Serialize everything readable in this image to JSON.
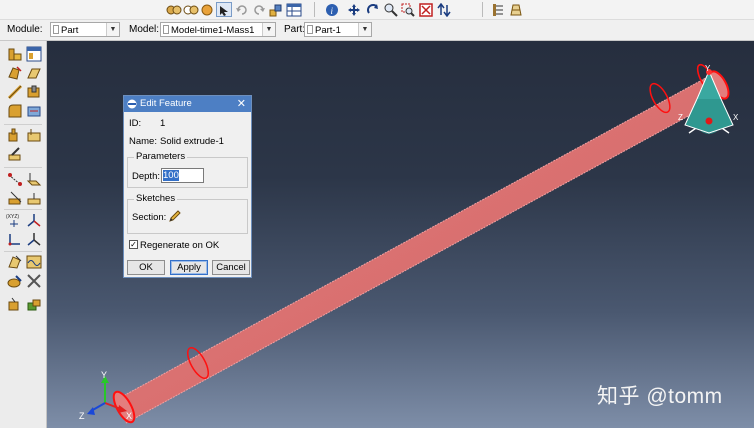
{
  "toolbar_icons": [
    "view-icon",
    "view2-icon",
    "ball-icon",
    "select-arrow-icon",
    "undo-icon",
    "redo-icon",
    "pan-icon",
    "table-icon",
    "info-icon",
    "move-icon",
    "rotate-icon",
    "zoom-icon",
    "zoom-box-icon",
    "fit-icon",
    "swap-icon",
    "tree-icon",
    "layer-icon"
  ],
  "context": {
    "module_label": "Module:",
    "module_value": "Part",
    "model_label": "Model:",
    "model_value": "Model-time1-Mass1",
    "part_label": "Part:",
    "part_value": "Part-1"
  },
  "dialog": {
    "title": "Edit Feature",
    "close": "✕",
    "id_label": "ID:",
    "id_value": "1",
    "name_label": "Name:",
    "name_value": "Solid extrude-1",
    "parameters_label": "Parameters",
    "depth_label": "Depth:",
    "depth_value": "100",
    "sketches_label": "Sketches",
    "section_label": "Section:",
    "regenerate_label": "Regenerate on OK",
    "regenerate_checked": "✓",
    "ok": "OK",
    "apply": "Apply",
    "cancel": "Cancel"
  },
  "triad_top": {
    "y": "Y",
    "z": "Z",
    "x": "X"
  },
  "triad_bottom": {
    "y": "Y",
    "z": "Z",
    "x": "X"
  },
  "watermark": "知乎 @tomm",
  "colors": {
    "title_bar": "#4d7fc4",
    "cylinder": "#d86c6c",
    "edge": "#ff1010",
    "viewport_top": "#262e3e",
    "viewport_bottom": "#7e8ea8"
  }
}
